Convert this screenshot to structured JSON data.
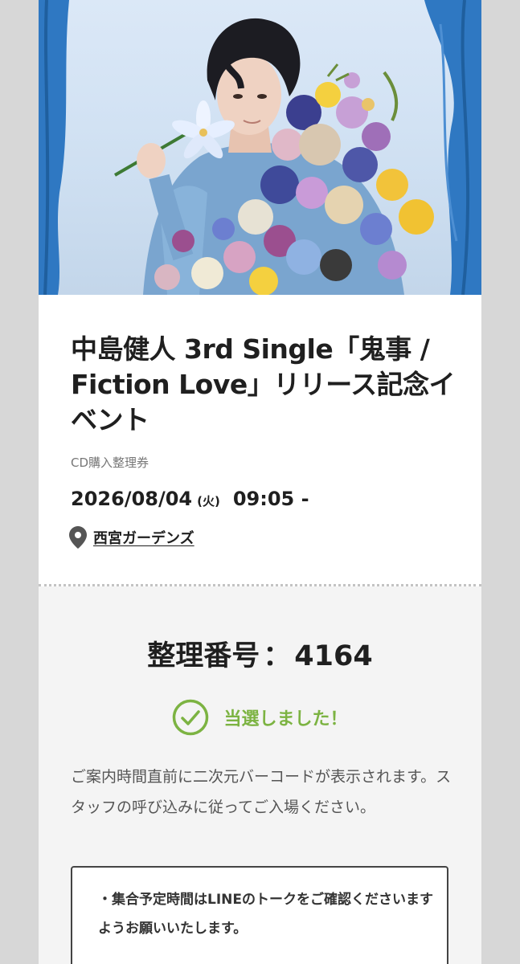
{
  "event": {
    "title": "中島健人 3rd Single「鬼事 / Fiction Love」リリース記念イベント",
    "ticket_type": "CD購入整理券",
    "date": "2026/08/04",
    "day_of_week": "(火)",
    "time": "09:05 -",
    "venue": "西宮ガーデンズ",
    "venue_icon": "map-pin-icon"
  },
  "ticket": {
    "number_label": "整理番号",
    "number_sep": "：",
    "number_value": "4164",
    "status_icon": "check-circle-icon",
    "status_text": "当選しました！",
    "status_color": "#7cb342",
    "notice": "ご案内時間直前に二次元バーコードが表示されます。スタッフの呼び込みに従ってご入場ください。",
    "memo": "・集合予定時間はLINEのトークをご確認くださいますようお願いいたします。"
  },
  "colors": {
    "curtain": "#2f78c2",
    "hero_background": "#d6e5f5",
    "ticket_background": "#f4f4f4"
  }
}
